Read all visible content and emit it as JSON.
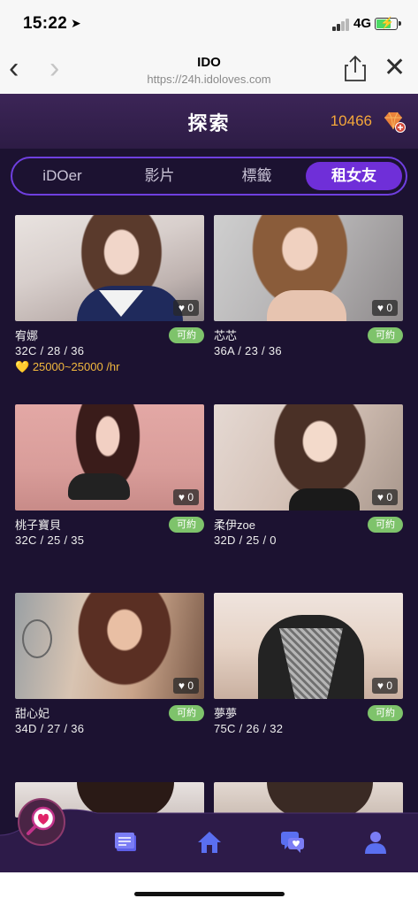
{
  "status_bar": {
    "time": "15:22",
    "location_icon": "location-arrow-icon",
    "network": "4G",
    "battery_color": "#4cd964"
  },
  "browser": {
    "title": "IDO",
    "url": "https://24h.idoloves.com"
  },
  "header": {
    "title": "探索",
    "coins": "10466",
    "coin_icon": "diamond-add-icon",
    "coin_color": "#f4a73a"
  },
  "tabs": [
    {
      "label": "iDOer",
      "active": false
    },
    {
      "label": "影片",
      "active": false
    },
    {
      "label": "標籤",
      "active": false
    },
    {
      "label": "租女友",
      "active": true
    }
  ],
  "profiles": [
    {
      "name": "宥娜",
      "stats": "32C / 28 / 36",
      "likes": "0",
      "badge": "可約",
      "price": "25000~25000 /hr"
    },
    {
      "name": "芯芯",
      "stats": "36A / 23 / 36",
      "likes": "0",
      "badge": "可約"
    },
    {
      "name": "桃子寶貝",
      "stats": "32C / 25 / 35",
      "likes": "0",
      "badge": "可約"
    },
    {
      "name": "柔伊zoe",
      "stats": "32D / 25 / 0",
      "likes": "0",
      "badge": "可約"
    },
    {
      "name": "甜心妃",
      "stats": "34D / 27 / 36",
      "likes": "0",
      "badge": "可約"
    },
    {
      "name": "夢夢",
      "stats": "75C / 26 / 32",
      "likes": "0",
      "badge": "可約"
    }
  ],
  "nav": {
    "items": [
      "heart-search-icon",
      "notes-icon",
      "home-icon",
      "chat-icon",
      "profile-icon"
    ]
  },
  "colors": {
    "accent": "#6f2fd8",
    "badge_green": "#7ec36b",
    "price_gold": "#f2b83e",
    "background": "#1c1231"
  }
}
